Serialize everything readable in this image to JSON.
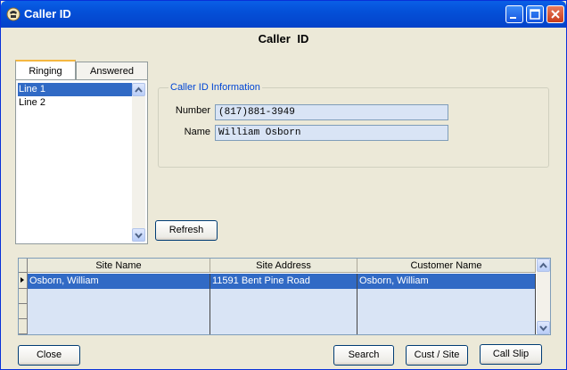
{
  "window": {
    "title": "Caller ID"
  },
  "heading": "Caller  ID",
  "tabs": [
    {
      "label": "Ringing",
      "active": true
    },
    {
      "label": "Answered",
      "active": false
    }
  ],
  "lines": [
    {
      "label": "Line 1",
      "selected": true
    },
    {
      "label": "Line 2",
      "selected": false
    }
  ],
  "caller_info": {
    "group_title": "Caller ID Information",
    "number_label": "Number",
    "number_value": "(817)881-3949",
    "name_label": "Name",
    "name_value": "William Osborn"
  },
  "refresh_label": "Refresh",
  "grid": {
    "columns": [
      "Site Name",
      "Site Address",
      "Customer Name"
    ],
    "rows": [
      [
        "Osborn, William",
        "11591 Bent Pine Road",
        "Osborn, William"
      ]
    ]
  },
  "buttons": {
    "close": "Close",
    "search": "Search",
    "cust_site": "Cust / Site",
    "call_slip": "Call Slip"
  },
  "colors": {
    "accent": "#316ac5",
    "titlebar": "#0450d8",
    "field_bg": "#d9e4f5"
  }
}
